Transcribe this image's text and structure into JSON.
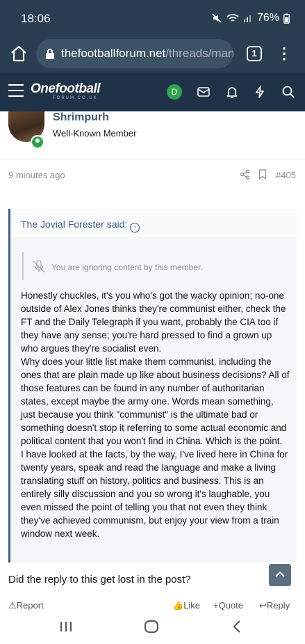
{
  "status_bar": {
    "time": "18:06",
    "battery": "76%"
  },
  "browser": {
    "url_domain": "thefootballforum.net",
    "url_path": "/threads/man",
    "tab_count": "1"
  },
  "site": {
    "logo_text": "Onefootball",
    "logo_subtext": "FORUM.CO.UK",
    "user_initial": "D",
    "colors": {
      "header_bg": "#1f3247",
      "browser_bg": "#2b3e51",
      "accent": "#3f5f86",
      "online": "#2fa34a"
    }
  },
  "post": {
    "author": "Shrimpurh",
    "author_title": "Well-Known Member",
    "time": "9 minutes ago",
    "number": "#405",
    "quote": {
      "author_said": "The Jovial Forester said:",
      "ignored_notice": "You are ignoring content by this member.",
      "paragraphs": [
        "Honestly chuckles, it's you who's got the wacky opinion; no-one outside of Alex Jones thinks they're communist either, check the FT and the Daily Telegraph if you want, probably the CIA too if they have any sense; you're hard pressed to find a grown up who argues they're socialist even.",
        "Why does your little list make them communist, including the ones that are plain made up like about business decisions? All of those features can be found in any number of authoritarian states, except maybe the army one. Words mean something, just because you think \"communist\" is the ultimate bad or something doesn't stop it referring to some actual economic and political content that you won't find in China. Which is the point.",
        "I have looked at the facts, by the way, I've lived here in China for twenty years, speak and read the language and make a living translating stuff on history, politics and business. This is an entirely silly discussion and you so wrong it's laughable, you even missed the point of telling you that not even they think they've achieved communism, but enjoy your view from a train window next week."
      ]
    },
    "reply": "Did the reply to this get lost in the post?",
    "actions": {
      "report": "Report",
      "like": "Like",
      "quote": "Quote",
      "reply": "Reply"
    }
  }
}
